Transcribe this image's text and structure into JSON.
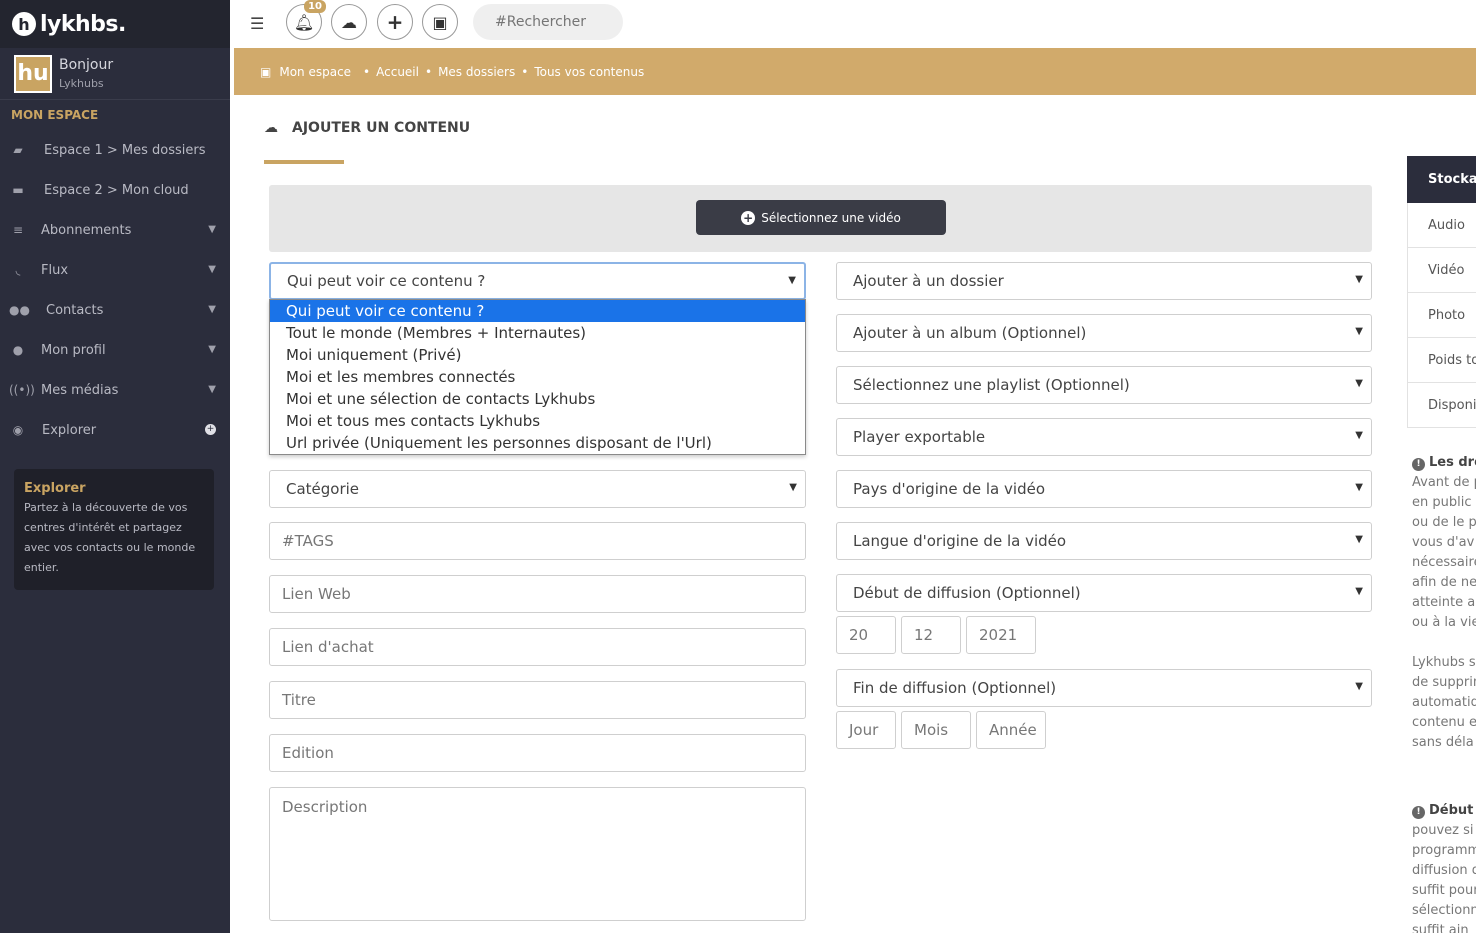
{
  "app": {
    "logo_mark": "h",
    "logo_text": "lykhbs."
  },
  "user": {
    "greeting": "Bonjour",
    "name": "Lykhubs",
    "avatar_letters": "hu"
  },
  "sidebar": {
    "section_title": "MON ESPACE",
    "items": [
      {
        "label": "Espace 1 > Mes dossiers",
        "icon": "folder-open-icon"
      },
      {
        "label": "Espace 2 > Mon cloud",
        "icon": "hard-drive-icon"
      },
      {
        "label": "Abonnements",
        "icon": "list-icon"
      },
      {
        "label": "Flux",
        "icon": "rss-icon"
      },
      {
        "label": "Contacts",
        "icon": "users-icon"
      },
      {
        "label": "Mon profil",
        "icon": "user-icon"
      },
      {
        "label": "Mes médias",
        "icon": "broadcast-icon"
      },
      {
        "label": "Explorer",
        "icon": "compass-icon"
      }
    ],
    "explore_card": {
      "title": "Explorer",
      "text": "Partez à la découverte de vos centres d'intérêt et partagez avec vos contacts ou le monde entier."
    }
  },
  "topbar": {
    "notification_count": "10",
    "search_placeholder": "#Rechercher"
  },
  "breadcrumb": {
    "home": "Mon espace",
    "items": [
      "Accueil",
      "Mes dossiers",
      "Tous vos contenus"
    ]
  },
  "page": {
    "title": "AJOUTER UN CONTENU",
    "select_video_label": "Sélectionnez une vidéo"
  },
  "form_left": {
    "visibility_select": "Qui peut voir ce contenu ?",
    "visibility_options": [
      "Qui peut voir ce contenu ?",
      "Tout le monde (Membres + Internautes)",
      "Moi uniquement (Privé)",
      "Moi et les membres connectés",
      "Moi et une sélection de contacts Lykhubs",
      "Moi et tous mes contacts Lykhubs",
      "Url privée (Uniquement les personnes disposant de l'Url)"
    ],
    "category_select": "Catégorie",
    "tags_placeholder": "#TAGS",
    "web_link_placeholder": "Lien Web",
    "purchase_link_placeholder": "Lien d'achat",
    "title_placeholder": "Titre",
    "edition_placeholder": "Edition",
    "description_placeholder": "Description"
  },
  "form_right": {
    "folder_select": "Ajouter à un dossier",
    "album_select": "Ajouter à un album (Optionnel)",
    "playlist_select": "Sélectionnez une playlist (Optionnel)",
    "player_select": "Player exportable",
    "country_select": "Pays d'origine de la vidéo",
    "language_select": "Langue d'origine de la vidéo",
    "start_select": "Début de diffusion (Optionnel)",
    "start_day": "20",
    "start_month": "12",
    "start_year": "2021",
    "end_select": "Fin de diffusion (Optionnel)",
    "end_day_placeholder": "Jour",
    "end_month_placeholder": "Mois",
    "end_year_placeholder": "Année"
  },
  "storage_panel": {
    "header": "Stockage",
    "rows": [
      "Audio",
      "Vidéo",
      "Photo",
      "Poids total",
      "Disponible"
    ]
  },
  "info_panel": {
    "rights_title": "Les droits",
    "rights_lines": [
      "Avant de p",
      "en public",
      "ou de le p",
      "vous d'av",
      "nécessaire",
      "afin de ne",
      "atteinte a",
      "ou à la vie"
    ],
    "rights_lines2": [
      "Lykhubs se",
      "de supprim",
      "automatiq",
      "contenu e",
      "sans déla"
    ],
    "start_title": "Début d",
    "start_lines": [
      "pouvez si",
      "programm",
      "diffusion d",
      "suffit pour",
      "sélectionn",
      "suffit ain"
    ]
  }
}
